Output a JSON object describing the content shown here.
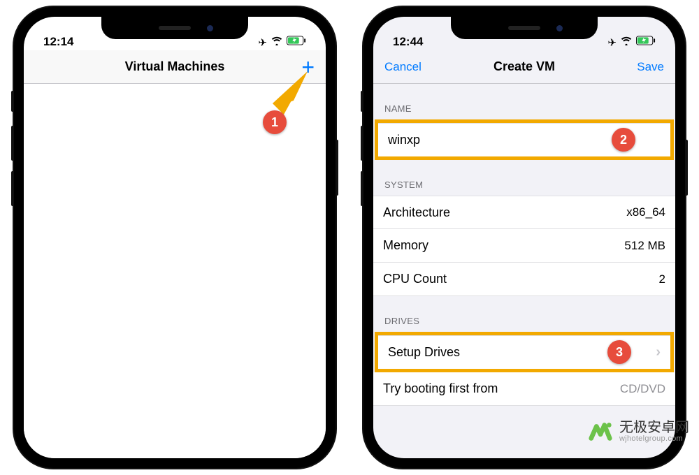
{
  "phones": {
    "left": {
      "status_time": "12:14",
      "nav_title": "Virtual Machines",
      "add_button_glyph": "+"
    },
    "right": {
      "status_time": "12:44",
      "nav_left": "Cancel",
      "nav_title": "Create VM",
      "nav_right": "Save",
      "sections": {
        "name": {
          "header": "NAME",
          "value": "winxp"
        },
        "system": {
          "header": "SYSTEM",
          "rows": [
            {
              "label": "Architecture",
              "value": "x86_64"
            },
            {
              "label": "Memory",
              "value": "512  MB"
            },
            {
              "label": "CPU Count",
              "value": "2"
            }
          ]
        },
        "drives": {
          "header": "DRIVES",
          "setup_label": "Setup Drives",
          "boot_label": "Try booting first from",
          "boot_value": "CD/DVD"
        }
      }
    }
  },
  "callouts": {
    "one": "1",
    "two": "2",
    "three": "3"
  },
  "watermark": {
    "line1": "无极安卓网",
    "line2": "wjhotelgroup.com"
  }
}
